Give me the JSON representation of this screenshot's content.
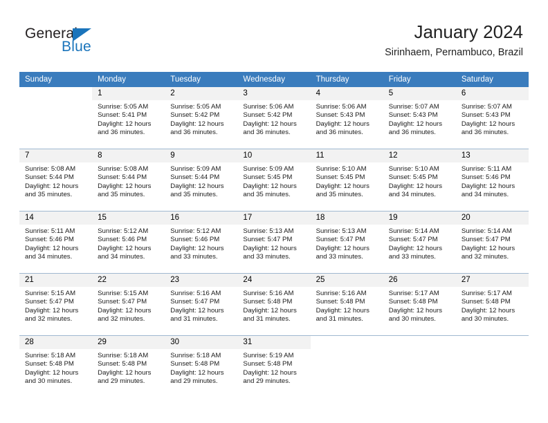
{
  "brand": {
    "name_part1": "General",
    "name_part2": "Blue",
    "triangle_color": "#1a74bb",
    "text_color": "#231f20"
  },
  "header": {
    "title": "January 2024",
    "subtitle": "Sirinhaem, Pernambuco, Brazil"
  },
  "theme": {
    "header_row_bg": "#3a7cbd",
    "header_row_text": "#ffffff",
    "daynum_bg": "#f2f2f2",
    "grid_line": "#9fb8d0"
  },
  "weekdays": [
    "Sunday",
    "Monday",
    "Tuesday",
    "Wednesday",
    "Thursday",
    "Friday",
    "Saturday"
  ],
  "weeks": [
    [
      {
        "day": "",
        "sunrise": "",
        "sunset": "",
        "daylight1": "",
        "daylight2": ""
      },
      {
        "day": "1",
        "sunrise": "Sunrise: 5:05 AM",
        "sunset": "Sunset: 5:41 PM",
        "daylight1": "Daylight: 12 hours",
        "daylight2": "and 36 minutes."
      },
      {
        "day": "2",
        "sunrise": "Sunrise: 5:05 AM",
        "sunset": "Sunset: 5:42 PM",
        "daylight1": "Daylight: 12 hours",
        "daylight2": "and 36 minutes."
      },
      {
        "day": "3",
        "sunrise": "Sunrise: 5:06 AM",
        "sunset": "Sunset: 5:42 PM",
        "daylight1": "Daylight: 12 hours",
        "daylight2": "and 36 minutes."
      },
      {
        "day": "4",
        "sunrise": "Sunrise: 5:06 AM",
        "sunset": "Sunset: 5:43 PM",
        "daylight1": "Daylight: 12 hours",
        "daylight2": "and 36 minutes."
      },
      {
        "day": "5",
        "sunrise": "Sunrise: 5:07 AM",
        "sunset": "Sunset: 5:43 PM",
        "daylight1": "Daylight: 12 hours",
        "daylight2": "and 36 minutes."
      },
      {
        "day": "6",
        "sunrise": "Sunrise: 5:07 AM",
        "sunset": "Sunset: 5:43 PM",
        "daylight1": "Daylight: 12 hours",
        "daylight2": "and 36 minutes."
      }
    ],
    [
      {
        "day": "7",
        "sunrise": "Sunrise: 5:08 AM",
        "sunset": "Sunset: 5:44 PM",
        "daylight1": "Daylight: 12 hours",
        "daylight2": "and 35 minutes."
      },
      {
        "day": "8",
        "sunrise": "Sunrise: 5:08 AM",
        "sunset": "Sunset: 5:44 PM",
        "daylight1": "Daylight: 12 hours",
        "daylight2": "and 35 minutes."
      },
      {
        "day": "9",
        "sunrise": "Sunrise: 5:09 AM",
        "sunset": "Sunset: 5:44 PM",
        "daylight1": "Daylight: 12 hours",
        "daylight2": "and 35 minutes."
      },
      {
        "day": "10",
        "sunrise": "Sunrise: 5:09 AM",
        "sunset": "Sunset: 5:45 PM",
        "daylight1": "Daylight: 12 hours",
        "daylight2": "and 35 minutes."
      },
      {
        "day": "11",
        "sunrise": "Sunrise: 5:10 AM",
        "sunset": "Sunset: 5:45 PM",
        "daylight1": "Daylight: 12 hours",
        "daylight2": "and 35 minutes."
      },
      {
        "day": "12",
        "sunrise": "Sunrise: 5:10 AM",
        "sunset": "Sunset: 5:45 PM",
        "daylight1": "Daylight: 12 hours",
        "daylight2": "and 34 minutes."
      },
      {
        "day": "13",
        "sunrise": "Sunrise: 5:11 AM",
        "sunset": "Sunset: 5:46 PM",
        "daylight1": "Daylight: 12 hours",
        "daylight2": "and 34 minutes."
      }
    ],
    [
      {
        "day": "14",
        "sunrise": "Sunrise: 5:11 AM",
        "sunset": "Sunset: 5:46 PM",
        "daylight1": "Daylight: 12 hours",
        "daylight2": "and 34 minutes."
      },
      {
        "day": "15",
        "sunrise": "Sunrise: 5:12 AM",
        "sunset": "Sunset: 5:46 PM",
        "daylight1": "Daylight: 12 hours",
        "daylight2": "and 34 minutes."
      },
      {
        "day": "16",
        "sunrise": "Sunrise: 5:12 AM",
        "sunset": "Sunset: 5:46 PM",
        "daylight1": "Daylight: 12 hours",
        "daylight2": "and 33 minutes."
      },
      {
        "day": "17",
        "sunrise": "Sunrise: 5:13 AM",
        "sunset": "Sunset: 5:47 PM",
        "daylight1": "Daylight: 12 hours",
        "daylight2": "and 33 minutes."
      },
      {
        "day": "18",
        "sunrise": "Sunrise: 5:13 AM",
        "sunset": "Sunset: 5:47 PM",
        "daylight1": "Daylight: 12 hours",
        "daylight2": "and 33 minutes."
      },
      {
        "day": "19",
        "sunrise": "Sunrise: 5:14 AM",
        "sunset": "Sunset: 5:47 PM",
        "daylight1": "Daylight: 12 hours",
        "daylight2": "and 33 minutes."
      },
      {
        "day": "20",
        "sunrise": "Sunrise: 5:14 AM",
        "sunset": "Sunset: 5:47 PM",
        "daylight1": "Daylight: 12 hours",
        "daylight2": "and 32 minutes."
      }
    ],
    [
      {
        "day": "21",
        "sunrise": "Sunrise: 5:15 AM",
        "sunset": "Sunset: 5:47 PM",
        "daylight1": "Daylight: 12 hours",
        "daylight2": "and 32 minutes."
      },
      {
        "day": "22",
        "sunrise": "Sunrise: 5:15 AM",
        "sunset": "Sunset: 5:47 PM",
        "daylight1": "Daylight: 12 hours",
        "daylight2": "and 32 minutes."
      },
      {
        "day": "23",
        "sunrise": "Sunrise: 5:16 AM",
        "sunset": "Sunset: 5:47 PM",
        "daylight1": "Daylight: 12 hours",
        "daylight2": "and 31 minutes."
      },
      {
        "day": "24",
        "sunrise": "Sunrise: 5:16 AM",
        "sunset": "Sunset: 5:48 PM",
        "daylight1": "Daylight: 12 hours",
        "daylight2": "and 31 minutes."
      },
      {
        "day": "25",
        "sunrise": "Sunrise: 5:16 AM",
        "sunset": "Sunset: 5:48 PM",
        "daylight1": "Daylight: 12 hours",
        "daylight2": "and 31 minutes."
      },
      {
        "day": "26",
        "sunrise": "Sunrise: 5:17 AM",
        "sunset": "Sunset: 5:48 PM",
        "daylight1": "Daylight: 12 hours",
        "daylight2": "and 30 minutes."
      },
      {
        "day": "27",
        "sunrise": "Sunrise: 5:17 AM",
        "sunset": "Sunset: 5:48 PM",
        "daylight1": "Daylight: 12 hours",
        "daylight2": "and 30 minutes."
      }
    ],
    [
      {
        "day": "28",
        "sunrise": "Sunrise: 5:18 AM",
        "sunset": "Sunset: 5:48 PM",
        "daylight1": "Daylight: 12 hours",
        "daylight2": "and 30 minutes."
      },
      {
        "day": "29",
        "sunrise": "Sunrise: 5:18 AM",
        "sunset": "Sunset: 5:48 PM",
        "daylight1": "Daylight: 12 hours",
        "daylight2": "and 29 minutes."
      },
      {
        "day": "30",
        "sunrise": "Sunrise: 5:18 AM",
        "sunset": "Sunset: 5:48 PM",
        "daylight1": "Daylight: 12 hours",
        "daylight2": "and 29 minutes."
      },
      {
        "day": "31",
        "sunrise": "Sunrise: 5:19 AM",
        "sunset": "Sunset: 5:48 PM",
        "daylight1": "Daylight: 12 hours",
        "daylight2": "and 29 minutes."
      },
      {
        "day": "",
        "sunrise": "",
        "sunset": "",
        "daylight1": "",
        "daylight2": ""
      },
      {
        "day": "",
        "sunrise": "",
        "sunset": "",
        "daylight1": "",
        "daylight2": ""
      },
      {
        "day": "",
        "sunrise": "",
        "sunset": "",
        "daylight1": "",
        "daylight2": ""
      }
    ]
  ]
}
